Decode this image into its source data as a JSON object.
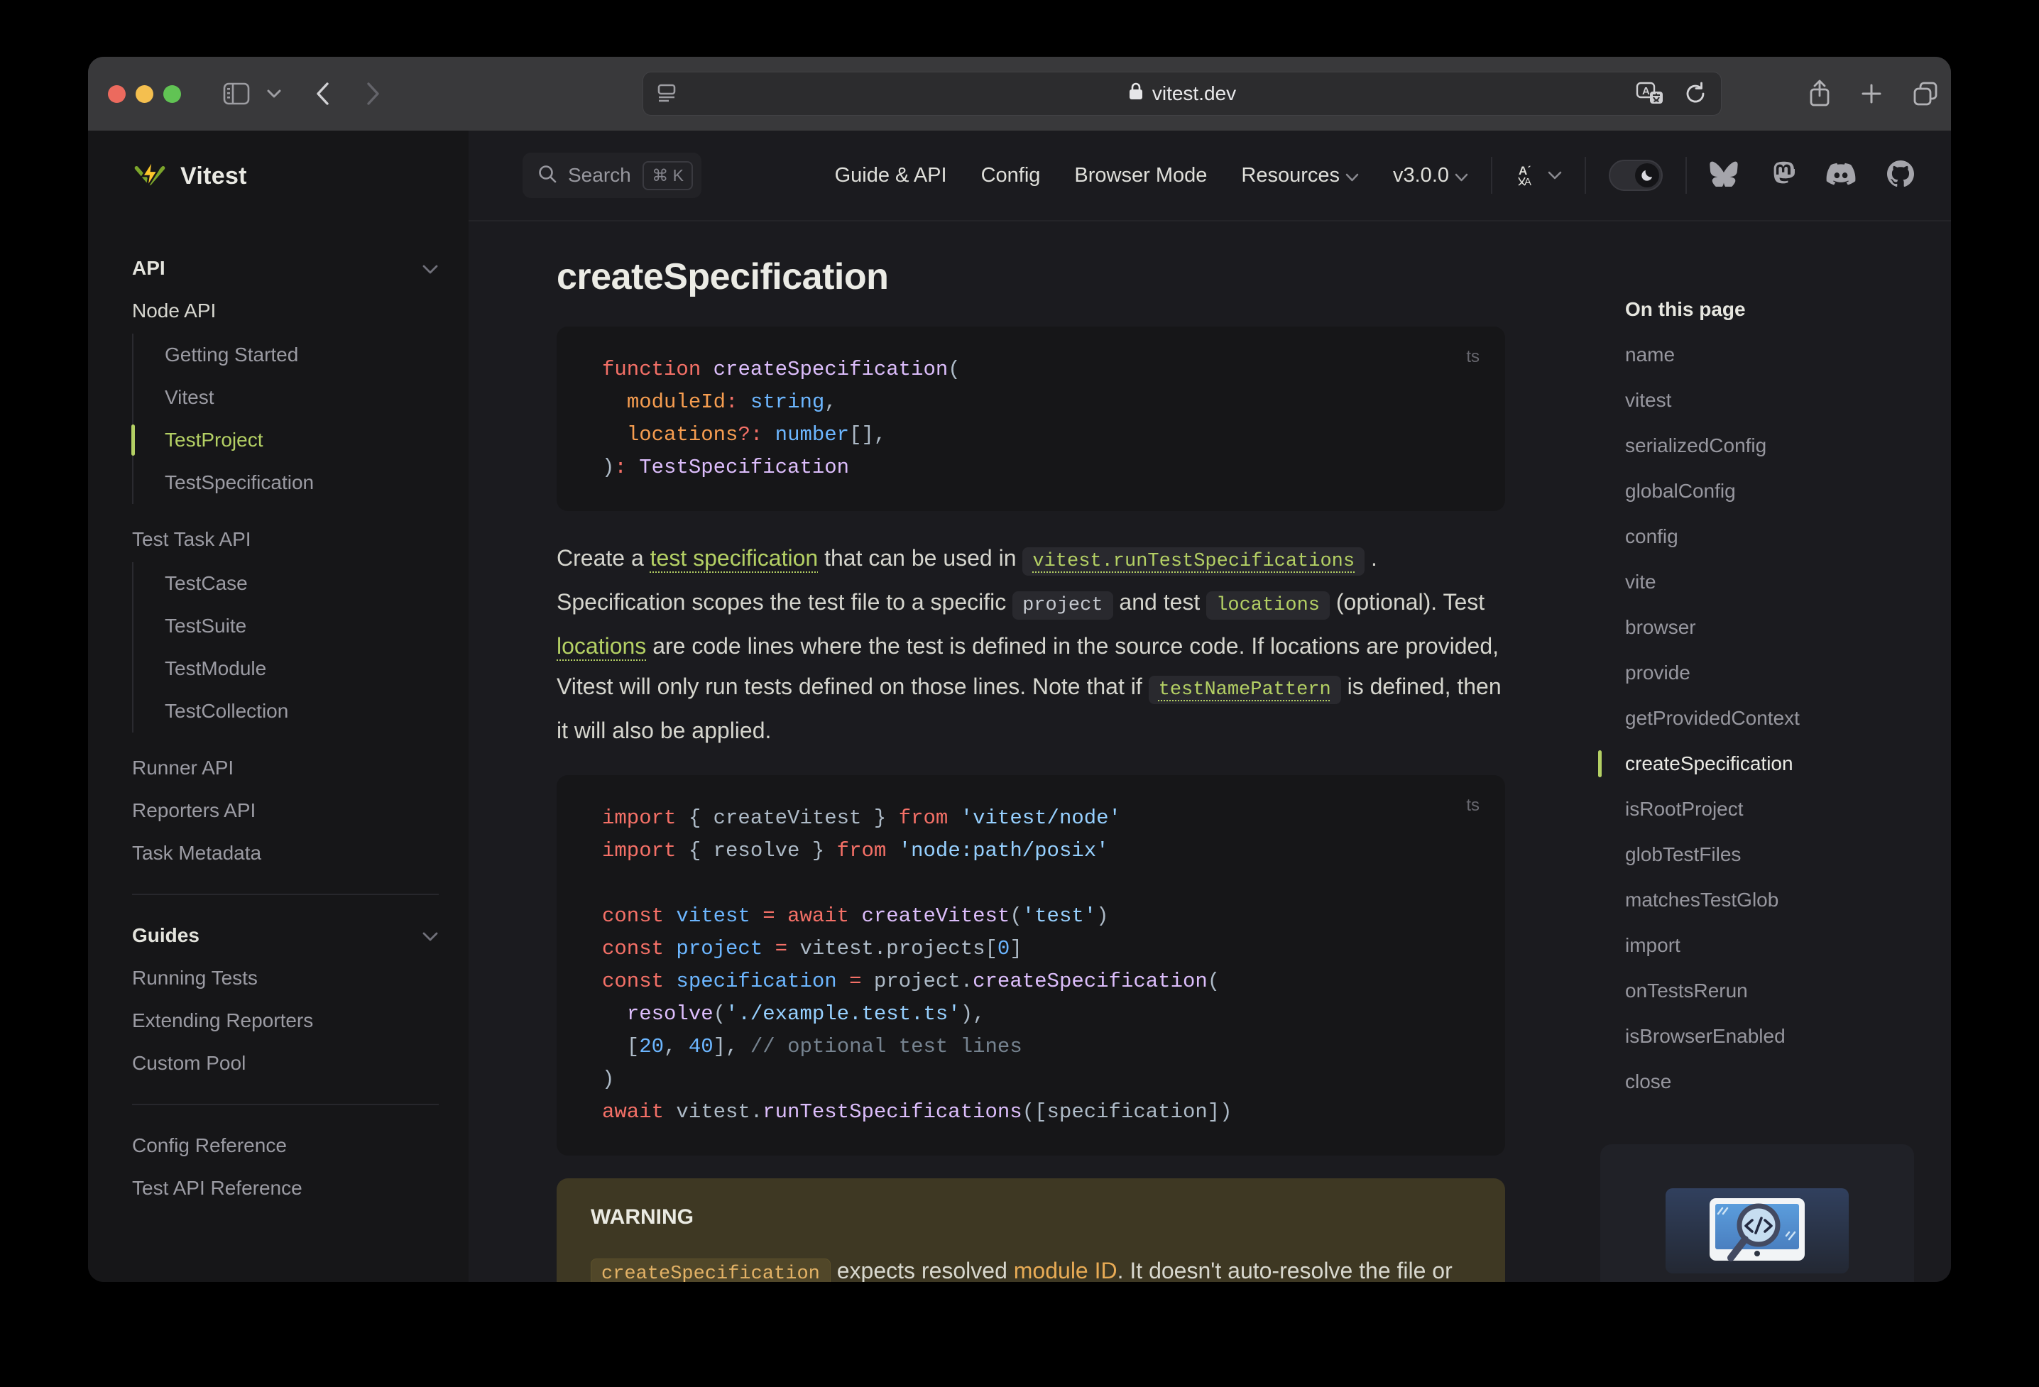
{
  "palette": {
    "accent": "#b4d064",
    "brand_yellow": "#fcc72b",
    "brand_green": "#7ba52b",
    "tok_keyword": "#f47067",
    "tok_fn": "#dcbdfb",
    "tok_var": "#6cb6ff",
    "tok_string": "#96d0ff",
    "tok_plain": "#adbac7",
    "tok_orange": "#f69d50",
    "tok_comment": "#768390",
    "warn_bg": "#3e3823",
    "warn_chip_bg": "#514729",
    "warn_chip_text": "#e3b266",
    "warn_link": "#e8ab55",
    "traffic_red": "#ec6a5e",
    "traffic_yellow": "#f4bf4f",
    "traffic_green": "#61c354"
  },
  "browser": {
    "url": "vitest.dev"
  },
  "brand": {
    "label": "Vitest"
  },
  "nav": {
    "search_label": "Search",
    "search_kbd": "⌘ K",
    "links": [
      "Guide & API",
      "Config",
      "Browser Mode"
    ],
    "dropdowns": [
      "Resources",
      "v3.0.0"
    ]
  },
  "sidebar": {
    "rows": [
      {
        "type": "header",
        "label": "API"
      },
      {
        "type": "link",
        "label": "Node API",
        "bright": true
      },
      {
        "type": "group",
        "items": [
          {
            "label": "Getting Started"
          },
          {
            "label": "Vitest"
          },
          {
            "label": "TestProject",
            "active": true
          },
          {
            "label": "TestSpecification"
          }
        ]
      },
      {
        "type": "link",
        "label": "Test Task API"
      },
      {
        "type": "group",
        "items": [
          {
            "label": "TestCase"
          },
          {
            "label": "TestSuite"
          },
          {
            "label": "TestModule"
          },
          {
            "label": "TestCollection"
          }
        ]
      },
      {
        "type": "link",
        "label": "Runner API"
      },
      {
        "type": "link",
        "label": "Reporters API"
      },
      {
        "type": "link",
        "label": "Task Metadata"
      },
      {
        "type": "divider"
      },
      {
        "type": "header",
        "label": "Guides"
      },
      {
        "type": "link",
        "label": "Running Tests"
      },
      {
        "type": "link",
        "label": "Extending Reporters"
      },
      {
        "type": "link",
        "label": "Custom Pool"
      },
      {
        "type": "divider"
      },
      {
        "type": "link",
        "label": "Config Reference"
      },
      {
        "type": "link",
        "label": "Test API Reference"
      }
    ]
  },
  "main": {
    "heading": "createSpecification",
    "code1": {
      "lang": "ts",
      "lines": [
        [
          [
            "k",
            "function"
          ],
          [
            "p",
            " "
          ],
          [
            "fn",
            "createSpecification"
          ],
          [
            "p",
            "("
          ]
        ],
        [
          [
            "p",
            "  "
          ],
          [
            "o",
            "moduleId"
          ],
          [
            "k",
            ":"
          ],
          [
            "p",
            " "
          ],
          [
            "v",
            "string"
          ],
          [
            "p",
            ","
          ]
        ],
        [
          [
            "p",
            "  "
          ],
          [
            "o",
            "locations"
          ],
          [
            "k",
            "?:"
          ],
          [
            "p",
            " "
          ],
          [
            "v",
            "number"
          ],
          [
            "p",
            "[],"
          ]
        ],
        [
          [
            "p",
            ")"
          ],
          [
            "k",
            ":"
          ],
          [
            "p",
            " "
          ],
          [
            "fn",
            "TestSpecification"
          ]
        ]
      ]
    },
    "paragraph": [
      {
        "t": "Create a ",
        "s": "plain"
      },
      {
        "t": "test specification",
        "s": "link"
      },
      {
        "t": " that can be used in ",
        "s": "plain"
      },
      {
        "t": "vitest.runTestSpecifications",
        "s": "code-link"
      },
      {
        "t": " . Specification scopes the test file to a specific ",
        "s": "plain"
      },
      {
        "t": "project",
        "s": "code"
      },
      {
        "t": " and test ",
        "s": "plain"
      },
      {
        "t": "locations",
        "s": "code-accent"
      },
      {
        "t": " (optional). Test ",
        "s": "plain"
      },
      {
        "t": "locations",
        "s": "link"
      },
      {
        "t": " are code lines where the test is defined in the source code. If locations are provided, Vitest will only run tests defined on those lines. Note that if ",
        "s": "plain"
      },
      {
        "t": "testNamePattern",
        "s": "code-link"
      },
      {
        "t": " is defined, then it will also be applied.",
        "s": "plain"
      }
    ],
    "code2": {
      "lang": "ts",
      "lines": [
        [
          [
            "k",
            "import"
          ],
          [
            "p",
            " { createVitest } "
          ],
          [
            "k",
            "from"
          ],
          [
            "p",
            " "
          ],
          [
            "s",
            "'vitest/node'"
          ]
        ],
        [
          [
            "k",
            "import"
          ],
          [
            "p",
            " { resolve } "
          ],
          [
            "k",
            "from"
          ],
          [
            "p",
            " "
          ],
          [
            "s",
            "'node:path/posix'"
          ]
        ],
        [],
        [
          [
            "k",
            "const"
          ],
          [
            "p",
            " "
          ],
          [
            "v",
            "vitest"
          ],
          [
            "p",
            " "
          ],
          [
            "k",
            "="
          ],
          [
            "p",
            " "
          ],
          [
            "k",
            "await"
          ],
          [
            "p",
            " "
          ],
          [
            "fn",
            "createVitest"
          ],
          [
            "p",
            "("
          ],
          [
            "s",
            "'test'"
          ],
          [
            "p",
            ")"
          ]
        ],
        [
          [
            "k",
            "const"
          ],
          [
            "p",
            " "
          ],
          [
            "v",
            "project"
          ],
          [
            "p",
            " "
          ],
          [
            "k",
            "="
          ],
          [
            "p",
            " vitest.projects["
          ],
          [
            "v",
            "0"
          ],
          [
            "p",
            "]"
          ]
        ],
        [
          [
            "k",
            "const"
          ],
          [
            "p",
            " "
          ],
          [
            "v",
            "specification"
          ],
          [
            "p",
            " "
          ],
          [
            "k",
            "="
          ],
          [
            "p",
            " project."
          ],
          [
            "fn",
            "createSpecification"
          ],
          [
            "p",
            "("
          ]
        ],
        [
          [
            "p",
            "  "
          ],
          [
            "fn",
            "resolve"
          ],
          [
            "p",
            "("
          ],
          [
            "s",
            "'./example.test.ts'"
          ],
          [
            "p",
            "),"
          ]
        ],
        [
          [
            "p",
            "  ["
          ],
          [
            "v",
            "20"
          ],
          [
            "p",
            ", "
          ],
          [
            "v",
            "40"
          ],
          [
            "p",
            "], "
          ],
          [
            "cm",
            "// optional test lines"
          ]
        ],
        [
          [
            "p",
            ")"
          ]
        ],
        [
          [
            "k",
            "await"
          ],
          [
            "p",
            " vitest."
          ],
          [
            "fn",
            "runTestSpecifications"
          ],
          [
            "p",
            "([specification])"
          ]
        ]
      ]
    },
    "warning": {
      "label": "WARNING",
      "segments": [
        {
          "t": "createSpecification",
          "s": "chip"
        },
        {
          "t": " expects resolved ",
          "s": "plain"
        },
        {
          "t": "module ID",
          "s": "link-warn"
        },
        {
          "t": ". It doesn't auto-resolve the file or check that it exists on the file system.",
          "s": "plain"
        }
      ]
    }
  },
  "outline": {
    "title": "On this page",
    "items": [
      {
        "label": "name"
      },
      {
        "label": "vitest"
      },
      {
        "label": "serializedConfig"
      },
      {
        "label": "globalConfig"
      },
      {
        "label": "config"
      },
      {
        "label": "vite"
      },
      {
        "label": "browser"
      },
      {
        "label": "provide"
      },
      {
        "label": "getProvidedContext"
      },
      {
        "label": "createSpecification",
        "active": true
      },
      {
        "label": "isRootProject"
      },
      {
        "label": "globTestFiles"
      },
      {
        "label": "matchesTestGlob"
      },
      {
        "label": "import"
      },
      {
        "label": "onTestsRerun"
      },
      {
        "label": "isBrowserEnabled"
      },
      {
        "label": "close"
      }
    ]
  }
}
